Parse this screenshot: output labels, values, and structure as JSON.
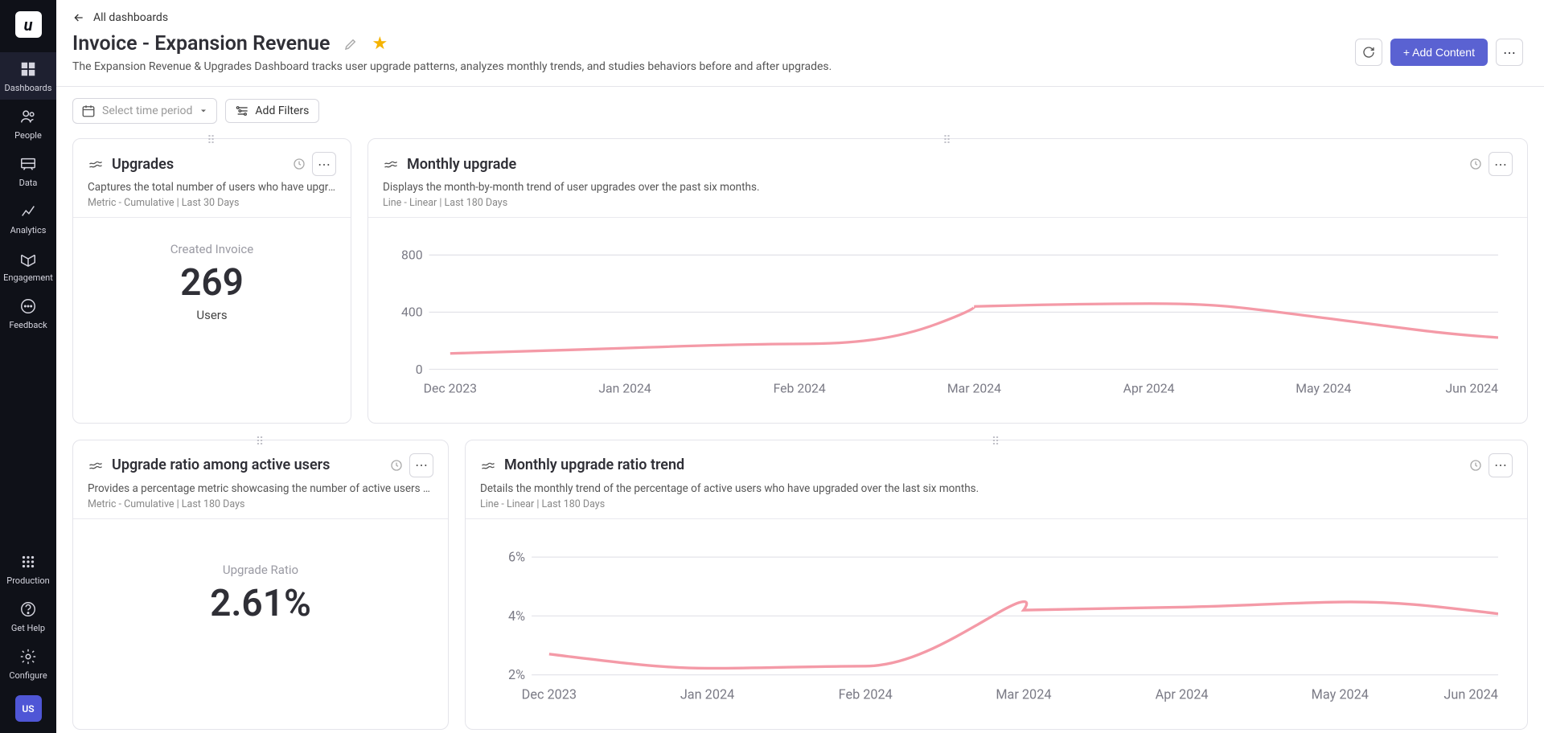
{
  "sidebar": {
    "logo": "u",
    "nav": [
      {
        "key": "dashboards",
        "label": "Dashboards"
      },
      {
        "key": "people",
        "label": "People"
      },
      {
        "key": "data",
        "label": "Data"
      },
      {
        "key": "analytics",
        "label": "Analytics"
      },
      {
        "key": "engagement",
        "label": "Engagement"
      },
      {
        "key": "feedback",
        "label": "Feedback"
      }
    ],
    "bottom": [
      {
        "key": "production",
        "label": "Production"
      },
      {
        "key": "gethelp",
        "label": "Get Help"
      },
      {
        "key": "configure",
        "label": "Configure"
      }
    ],
    "avatar": "US"
  },
  "header": {
    "back": "All dashboards",
    "title": "Invoice - Expansion Revenue",
    "description": "The Expansion Revenue & Upgrades Dashboard tracks user upgrade patterns, analyzes monthly trends, and studies behaviors before and after upgrades.",
    "timePlaceholder": "Select time period",
    "addFilters": "Add Filters",
    "addContent": "+  Add Content"
  },
  "cards": {
    "upgrades": {
      "title": "Upgrades",
      "desc": "Captures the total number of users who have upgrade...",
      "meta": "Metric - Cumulative | Last 30 Days",
      "metricLabel": "Created Invoice",
      "metricValue": "269",
      "metricUnit": "Users"
    },
    "monthlyUpgrade": {
      "title": "Monthly upgrade",
      "desc": "Displays the month-by-month trend of user upgrades over the past six months.",
      "meta": "Line - Linear | Last 180 Days"
    },
    "upgradeRatio": {
      "title": "Upgrade ratio among active users",
      "desc": "Provides a percentage metric showcasing the number of active users who ch...",
      "meta": "Metric - Cumulative | Last 180 Days",
      "metricLabel": "Upgrade Ratio",
      "metricValue": "2.61%"
    },
    "monthlyRatio": {
      "title": "Monthly upgrade ratio trend",
      "desc": "Details the monthly trend of the percentage of active users who have upgraded over the last six months.",
      "meta": "Line - Linear | Last 180 Days"
    }
  },
  "chart_data": [
    {
      "type": "line",
      "title": "Monthly upgrade",
      "categories": [
        "Dec 2023",
        "Jan 2024",
        "Feb 2024",
        "Mar 2024",
        "Apr 2024",
        "May 2024",
        "Jun 2024"
      ],
      "values": [
        110,
        150,
        180,
        440,
        460,
        360,
        220
      ],
      "ylabel": "",
      "ylim": [
        0,
        800
      ],
      "yticks": [
        0,
        400,
        800
      ]
    },
    {
      "type": "line",
      "title": "Monthly upgrade ratio trend",
      "categories": [
        "Dec 2023",
        "Jan 2024",
        "Feb 2024",
        "Mar 2024",
        "Apr 2024",
        "May 2024",
        "Jun 2024"
      ],
      "values": [
        2.7,
        2.2,
        2.3,
        4.2,
        4.3,
        4.4,
        4.0
      ],
      "ylabel": "",
      "ylim": [
        2,
        6
      ],
      "yticks": [
        "2%",
        "4%",
        "6%"
      ]
    }
  ]
}
